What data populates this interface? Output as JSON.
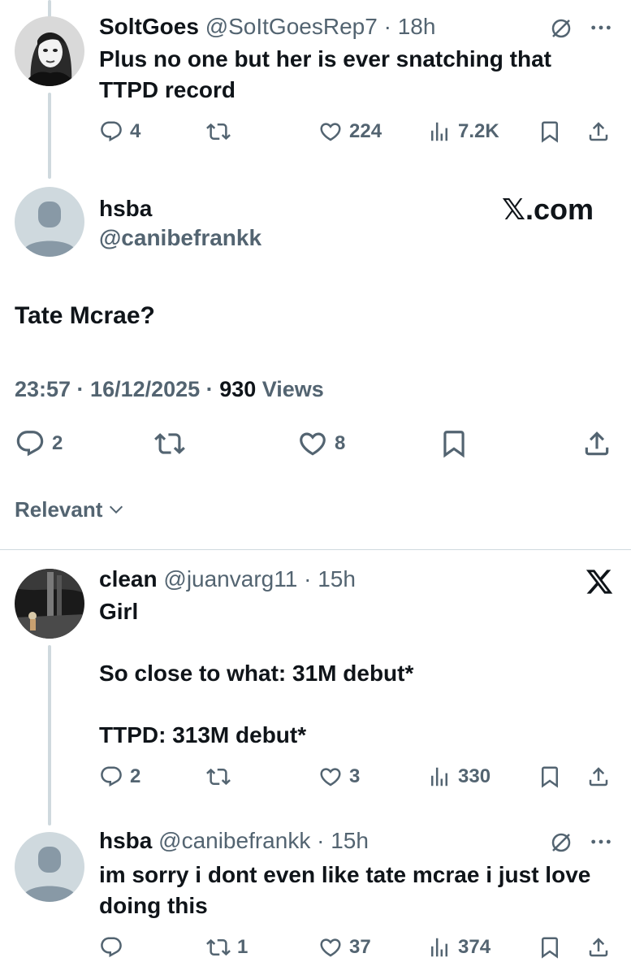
{
  "reply1": {
    "name": "SoltGoes",
    "handle": "@SoItGoesRep7",
    "time": "18h",
    "text": "Plus no one but her is ever snatching that TTPD record",
    "stats": {
      "replies": "4",
      "reposts": "",
      "likes": "224",
      "views": "7.2K"
    },
    "avatar_icon": "profile-photo-woman"
  },
  "main": {
    "name": "hsba",
    "handle": "@canibefrankk",
    "watermark": "𝕏.com",
    "text": "Tate Mcrae?",
    "timestamp": "23:57 · 16/12/2025 · ",
    "views_count": "930",
    "views_label": " Views",
    "stats": {
      "replies": "2",
      "reposts": "",
      "likes": "8"
    }
  },
  "sort": {
    "label": "Relevant"
  },
  "reply2": {
    "name": "clean",
    "handle": "@juanvarg11",
    "time": "15h",
    "text": "Girl\n\nSo close to what: 31M debut*\n\nTTPD: 313M debut*",
    "stats": {
      "replies": "2",
      "reposts": "",
      "likes": "3",
      "views": "330"
    },
    "brand_icon": "x-logo-icon"
  },
  "reply3": {
    "name": "hsba",
    "handle": "@canibefrankk",
    "time": "15h",
    "text": "im sorry i dont even like tate mcrae i just love doing this",
    "stats": {
      "replies": "",
      "reposts": "1",
      "likes": "37",
      "views": "374"
    }
  },
  "colors": {
    "text": "#0f1419",
    "secondary": "#536471",
    "line": "#cfd9de",
    "default_avatar_bg": "#cfd9de",
    "default_avatar_fg": "#8899a6"
  }
}
